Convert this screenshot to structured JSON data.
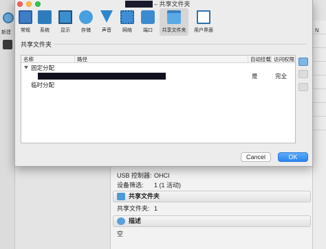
{
  "background": {
    "left_new_label": "新建",
    "right_label": "N",
    "usb": {
      "key": "USB 控制器:",
      "value": "OHCI"
    },
    "device_filter": {
      "key": "设备筛选:",
      "value": "1 (1 活动)"
    },
    "shared_section": {
      "title": "共享文件夹",
      "icon": "folder-icon"
    },
    "shared_row": {
      "key": "共享文件夹:",
      "value": "1"
    },
    "desc_section": {
      "title": "描述",
      "icon": "description-icon"
    },
    "desc_value": "空"
  },
  "dialog": {
    "title": "– 共享文件夹",
    "toolbar": [
      {
        "label": "常规",
        "icon": "general-icon"
      },
      {
        "label": "系统",
        "icon": "system-icon"
      },
      {
        "label": "显示",
        "icon": "display-icon"
      },
      {
        "label": "存储",
        "icon": "storage-icon"
      },
      {
        "label": "声音",
        "icon": "audio-icon"
      },
      {
        "label": "网络",
        "icon": "network-icon"
      },
      {
        "label": "端口",
        "icon": "ports-icon"
      },
      {
        "label": "共享文件夹",
        "icon": "shared-folder-icon",
        "active": true
      },
      {
        "label": "用户界面",
        "icon": "user-interface-icon"
      }
    ],
    "section_title": "共享文件夹",
    "table": {
      "headers": [
        "名称",
        "路径",
        "自动挂载",
        "访问权限"
      ],
      "rows": [
        {
          "name": "固定分配",
          "type": "group",
          "expanded": true
        },
        {
          "name": "",
          "path": "",
          "auto_mount": "是",
          "access": "完全",
          "type": "item"
        },
        {
          "name": "临时分配",
          "type": "group"
        }
      ]
    },
    "side_buttons": [
      "add-folder-icon",
      "edit-folder-icon",
      "remove-folder-icon"
    ],
    "buttons": {
      "cancel": "Cancel",
      "ok": "OK"
    }
  },
  "colors": {
    "accent": "#2b86f0",
    "close": "#fc605c",
    "minimize": "#fdbc40",
    "maximize": "#34c84a"
  }
}
